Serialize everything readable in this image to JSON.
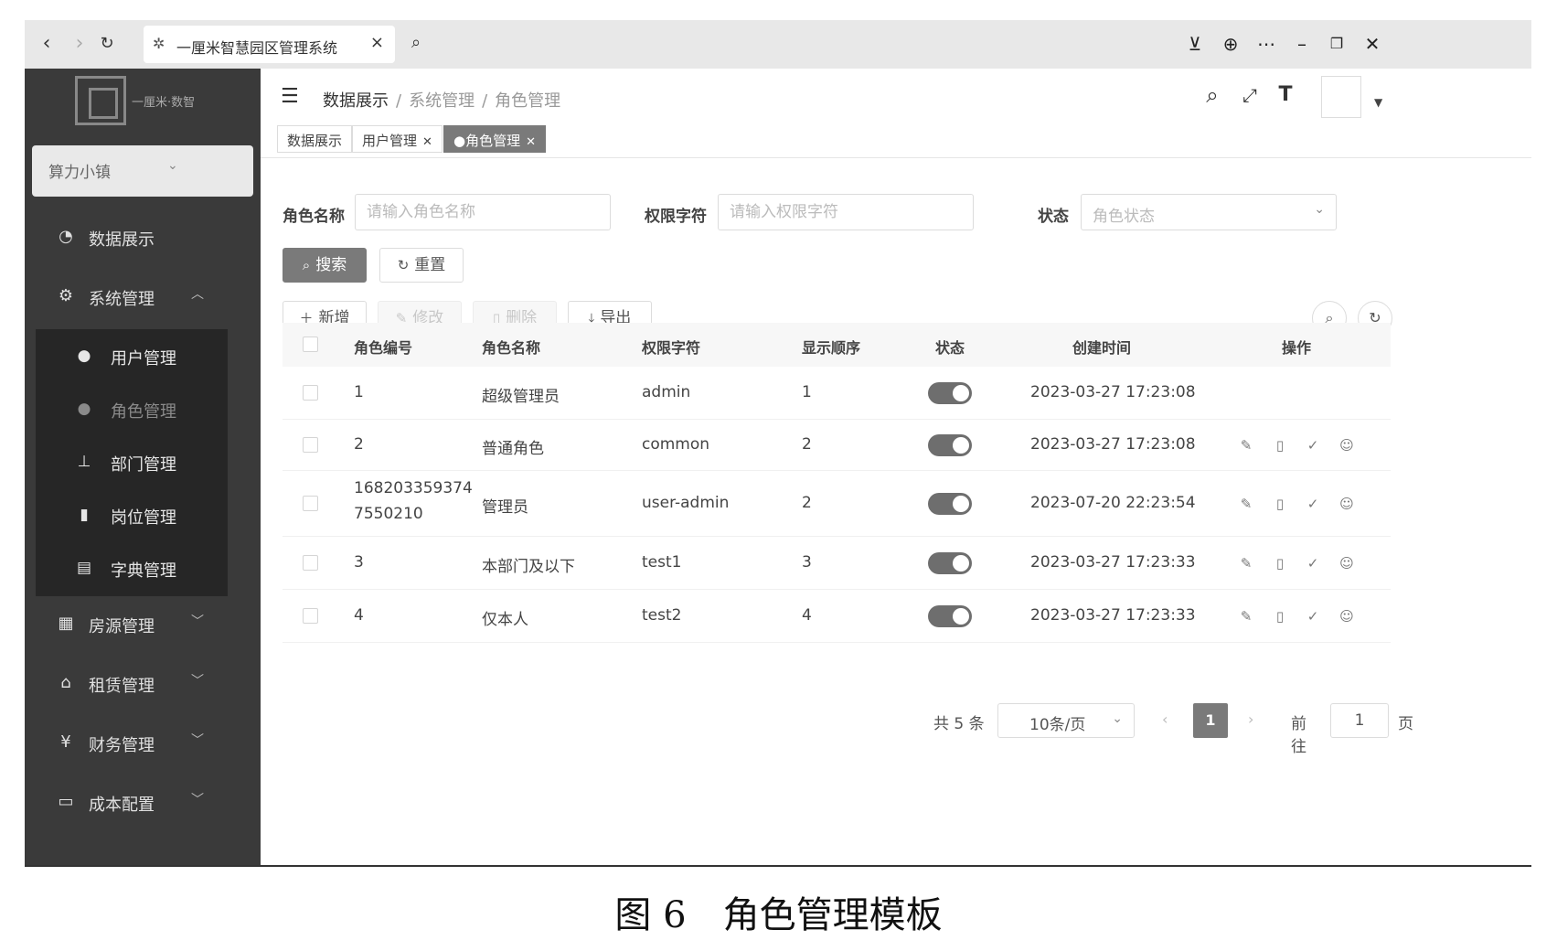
{
  "browser": {
    "tab_title": "一厘米智慧园区管理系统",
    "icons": [
      "back-icon",
      "forward-icon",
      "reload-icon",
      "search-icon",
      "download-icon",
      "globe-icon",
      "more-icon",
      "minimize-icon",
      "restore-icon",
      "close-icon"
    ]
  },
  "sidebar": {
    "logo_text": "一厘米·数智",
    "org_select": "算力小镇",
    "menu": [
      {
        "label": "数据展示",
        "icon": "dashboard-icon"
      },
      {
        "label": "系统管理",
        "icon": "gear-icon",
        "expanded": true
      },
      {
        "label": "房源管理",
        "icon": "grid-icon"
      },
      {
        "label": "租赁管理",
        "icon": "house-icon"
      },
      {
        "label": "财务管理",
        "icon": "yen-icon"
      },
      {
        "label": "成本配置",
        "icon": "monitor-icon"
      }
    ],
    "submenu": [
      {
        "label": "用户管理",
        "icon": "user-icon"
      },
      {
        "label": "角色管理",
        "icon": "role-icon",
        "active": true
      },
      {
        "label": "部门管理",
        "icon": "tree-icon"
      },
      {
        "label": "岗位管理",
        "icon": "post-icon"
      },
      {
        "label": "字典管理",
        "icon": "dict-icon"
      }
    ]
  },
  "header": {
    "breadcrumb": [
      "数据展示",
      "系统管理",
      "角色管理"
    ],
    "icons": [
      "search-icon",
      "fullscreen-icon",
      "font-size-icon",
      "avatar",
      "caret-down-icon"
    ]
  },
  "tags": [
    {
      "label": "数据展示",
      "closable": false
    },
    {
      "label": "用户管理",
      "closable": true
    },
    {
      "label": "●角色管理",
      "closable": true,
      "active": true
    }
  ],
  "filters": {
    "role_name_label": "角色名称",
    "role_name_placeholder": "请输入角色名称",
    "perm_label": "权限字符",
    "perm_placeholder": "请输入权限字符",
    "status_label": "状态",
    "status_placeholder": "角色状态",
    "search_btn": "搜索",
    "reset_btn": "重置"
  },
  "toolbar": {
    "add": "新增",
    "edit": "修改",
    "delete": "删除",
    "export": "导出"
  },
  "table": {
    "columns": [
      "角色编号",
      "角色名称",
      "权限字符",
      "显示顺序",
      "状态",
      "创建时间",
      "操作"
    ],
    "rows": [
      {
        "id": "1",
        "id2": "",
        "name": "超级管理员",
        "key": "admin",
        "sort": "1",
        "status": true,
        "created": "2023-03-27 17:23:08",
        "ops": false
      },
      {
        "id": "2",
        "id2": "",
        "name": "普通角色",
        "key": "common",
        "sort": "2",
        "status": true,
        "created": "2023-03-27 17:23:08",
        "ops": true
      },
      {
        "id": "168203359374",
        "id2": "7550210",
        "name": "管理员",
        "key": "user-admin",
        "sort": "2",
        "status": true,
        "created": "2023-07-20 22:23:54",
        "ops": true
      },
      {
        "id": "3",
        "id2": "",
        "name": "本部门及以下",
        "key": "test1",
        "sort": "3",
        "status": true,
        "created": "2023-03-27 17:23:33",
        "ops": true
      },
      {
        "id": "4",
        "id2": "",
        "name": "仅本人",
        "key": "test2",
        "sort": "4",
        "status": true,
        "created": "2023-03-27 17:23:33",
        "ops": true
      }
    ]
  },
  "pagination": {
    "total": "共 5 条",
    "page_size": "10条/页",
    "current": "1",
    "goto_label": "前往",
    "goto_value": "1",
    "page_suffix": "页"
  },
  "caption": "图 6　角色管理模板"
}
